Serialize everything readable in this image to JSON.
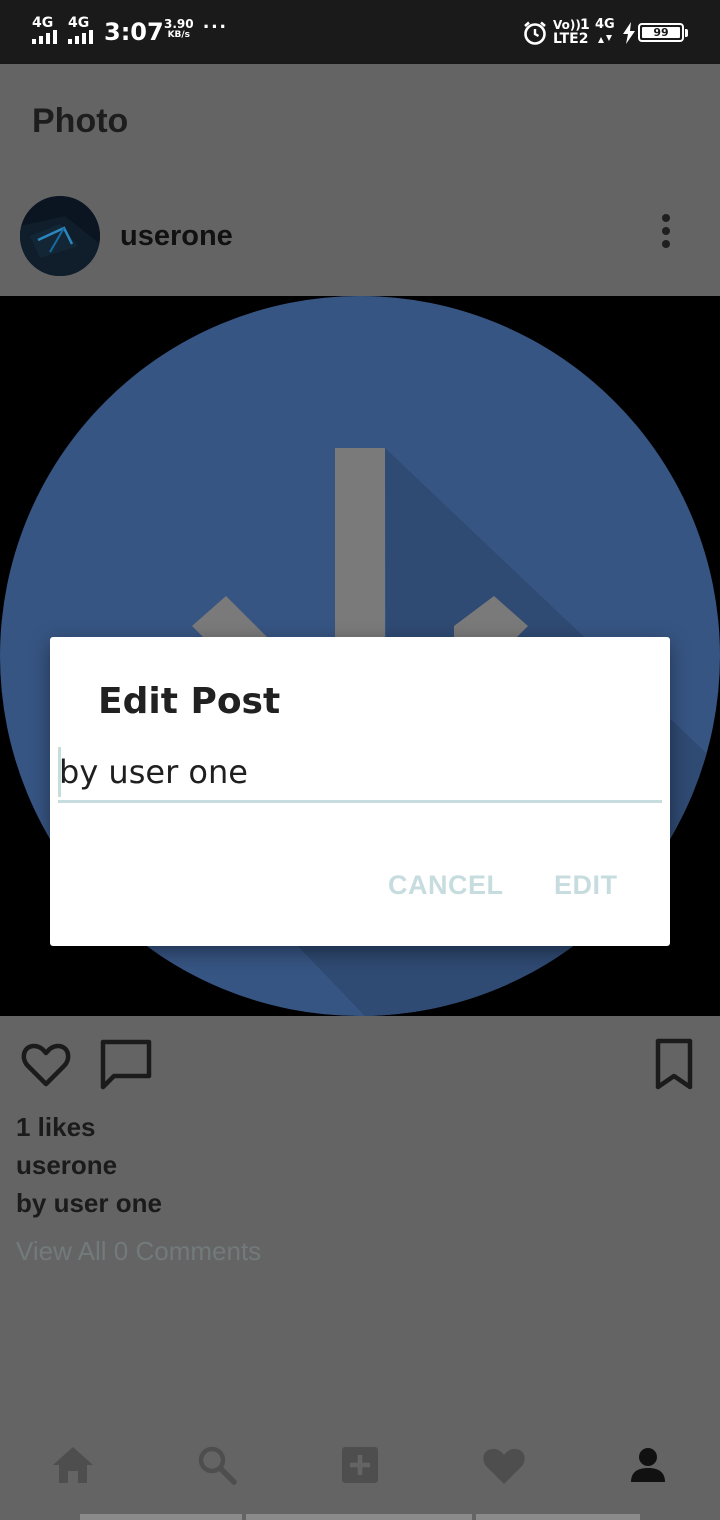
{
  "status_bar": {
    "network_1": "4G",
    "network_2": "4G",
    "time": "3:07",
    "speed_value": "3.90",
    "speed_unit": "KB/s",
    "overflow": "···",
    "volte": "Vo))",
    "lte": "LTE2",
    "sim_slot": "1",
    "network_3": "4G",
    "battery": "99",
    "icons": [
      "signal-icon",
      "alarm-icon",
      "charging-icon",
      "battery-icon"
    ]
  },
  "app_bar": {
    "title": "Photo"
  },
  "post": {
    "username": "userone",
    "likes": "1 likes",
    "owner": "userone",
    "caption": "by user one",
    "comments_link": "View All 0 Comments",
    "actions": [
      "heart-icon",
      "comment-icon",
      "bookmark-icon"
    ]
  },
  "dialog": {
    "title": "Edit Post",
    "input_value": "by user one",
    "cancel_label": "CANCEL",
    "edit_label": "EDIT"
  },
  "bottom_nav": {
    "items": [
      "home-icon",
      "search-icon",
      "add-icon",
      "heart-icon",
      "profile-icon"
    ]
  },
  "colors": {
    "scrim": "#646464",
    "image_circle": "#3b5a8a",
    "dialog_bg": "#ffffff",
    "dialog_button": "#c7dcdf",
    "link": "#727a7c"
  }
}
